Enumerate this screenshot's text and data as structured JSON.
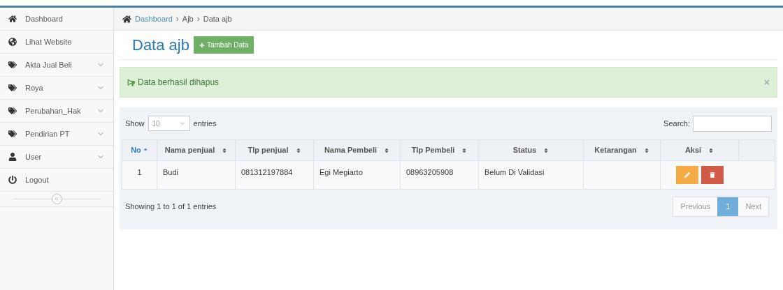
{
  "sidebar": {
    "items": [
      {
        "label": "Dashboard",
        "expandable": false
      },
      {
        "label": "Lihat Website",
        "expandable": false
      },
      {
        "label": "Akta Jual Beli",
        "expandable": true
      },
      {
        "label": "Roya",
        "expandable": true
      },
      {
        "label": "Perubahan_Hak",
        "expandable": true
      },
      {
        "label": "Pendirian PT",
        "expandable": true
      },
      {
        "label": "User",
        "expandable": true
      },
      {
        "label": "Logout",
        "expandable": false
      }
    ],
    "collapse_button": "«"
  },
  "breadcrumb": {
    "items": [
      "Dashboard",
      "Ajb",
      "Data ajb"
    ],
    "separators": [
      "›",
      "›"
    ]
  },
  "page_title": "Data ajb",
  "add_button": "Tambah Data",
  "alert": {
    "text": "Data berhasil dihapus",
    "close": "×"
  },
  "length_control": {
    "show": "Show",
    "value": "10",
    "entries": "entries"
  },
  "search": {
    "label": "Search:"
  },
  "table": {
    "columns": [
      {
        "label": "No",
        "sorted": true
      },
      {
        "label": "Nama penjual",
        "sorted": false
      },
      {
        "label": "Tlp penjual",
        "sorted": false
      },
      {
        "label": "Nama Pembeli",
        "sorted": false
      },
      {
        "label": "Tlp Pembeli",
        "sorted": false
      },
      {
        "label": "Status",
        "sorted": false
      },
      {
        "label": "Ketarangan",
        "sorted": false
      },
      {
        "label": "Aksi",
        "sorted": false
      }
    ],
    "rows": [
      {
        "cells": [
          "1",
          "Budi",
          "081312197884",
          "Egi Megiarto",
          "08963205908",
          "Belum Di Validasi",
          null
        ]
      }
    ]
  },
  "info": "Showing 1 to 1 of 1 entries",
  "pagination": [
    {
      "label": "Previous",
      "kind": "nav",
      "selected": false
    },
    {
      "label": "1",
      "kind": "page",
      "selected": true
    },
    {
      "label": "Next",
      "kind": "nav",
      "selected": false
    }
  ]
}
